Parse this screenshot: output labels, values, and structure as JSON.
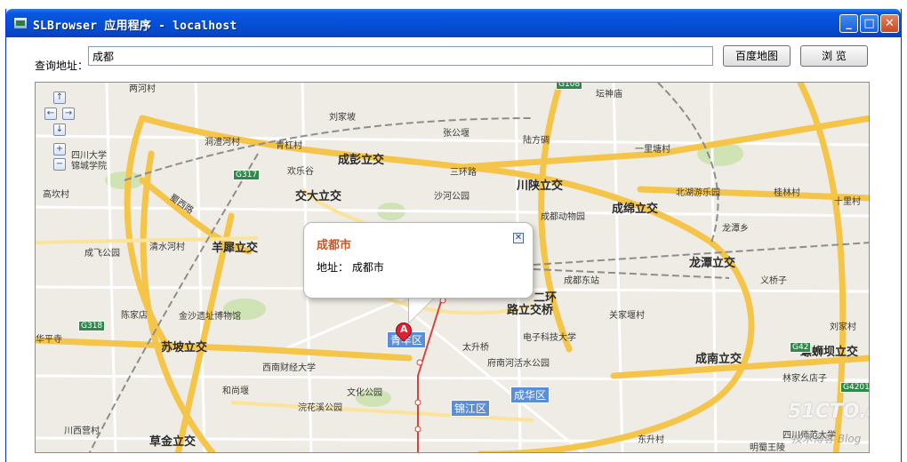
{
  "window": {
    "title": "SLBrowser 应用程序 - localhost",
    "minimize_label": "_",
    "maximize_label": "□",
    "close_label": "✕"
  },
  "search": {
    "label": "查询地址：",
    "value": "成都",
    "baidu_button": "百度地图",
    "browse_button": "浏 览"
  },
  "map": {
    "nav": {
      "up": "↑",
      "left": "←",
      "right": "→",
      "down": "↓",
      "zoom_in": "+",
      "zoom_out": "−"
    },
    "popup": {
      "title": "成都市",
      "body": "地址： 成都市",
      "close": "✕"
    },
    "marker_letter": "A",
    "labels": {
      "l01": "两河村",
      "l02": "坛神庙",
      "l03": "刘家坡",
      "l04": "张公堰",
      "l05": "陆方碉",
      "l06": "洞澧河村",
      "l07": "青杠村",
      "l08": "一里塘村",
      "l09": "成彭立交",
      "l10": "四川大学",
      "l11": "锦城学院",
      "l12": "欢乐谷",
      "l13": "三环路",
      "l14": "川陕立交",
      "l15": "高坎村",
      "l16": "交大立交",
      "l17": "沙河公园",
      "l18": "北湖游乐园",
      "l19": "桂林村",
      "l20": "十里村",
      "l21": "蜀西路",
      "l22": "成都动物园",
      "l23": "成绵立交",
      "l24": "龙潭乡",
      "l25": "清水河村",
      "l26": "羊犀立交",
      "l27": "成飞公园",
      "l28": "龙潭立交",
      "l29": "成都东站",
      "l30": "义桥子",
      "l31": "二环",
      "l32": "路立交桥",
      "l33": "陈家店",
      "l34": "金沙遗址博物馆",
      "l35": "关家堰村",
      "l36": "华平寺",
      "l37": "苏坡立交",
      "l38": "电子科技大学",
      "l39": "刘家村",
      "l40": "太升桥",
      "l41": "螺蛳坝立交",
      "l42": "西南财经大学",
      "l43": "府南河活水公园",
      "l44": "成南立交",
      "l45": "林家幺店子",
      "l46": "和尚堰",
      "l47": "文化公园",
      "l48": "成华区",
      "l49": "浣花溪公园",
      "l50": "锦江区",
      "l51": "川西营村",
      "l52": "东升村",
      "l53": "草金立交",
      "l54": "四川师范大学",
      "l55": "明蜀王陵",
      "l56": "青羊区"
    },
    "shields": {
      "g317": "G317",
      "g318": "G318",
      "g42": "G42",
      "g4201": "G4201",
      "g108": "G108"
    }
  },
  "watermark": {
    "site": "51CTO.com",
    "blog": "技术博客  Blog"
  }
}
